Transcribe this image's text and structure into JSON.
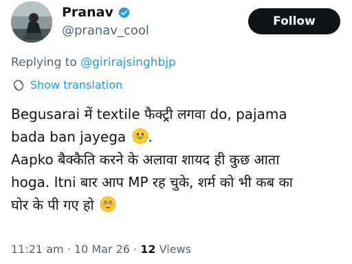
{
  "author": {
    "name": "Pranav",
    "handle": "@pranav_cool",
    "verified": true,
    "verified_color": "#1d9bf0"
  },
  "follow_button": {
    "label": "Follow"
  },
  "reply_context": {
    "prefix": "Replying to",
    "mention": "@girirajsinghbjp"
  },
  "translation": {
    "label": "Show translation",
    "icon": "globe-icon"
  },
  "tweet": {
    "lines": [
      "Begusarai में textile फैक्ट्री लगवा do, pajama",
      "bada ban jayega",
      "Aapko बैक्कैति करने के अलावा शायद ही कुछ आता",
      "hoga. Itni बार आप MP रह चुके, शर्म को भी कब का",
      "घोर के पी गए हो"
    ],
    "emojis": [
      "grinning-face-emoji",
      "flushed-face-emoji"
    ]
  },
  "meta": {
    "time": "11:21 am",
    "separator": "·",
    "date": "10 Mar 26",
    "views_count": "12",
    "views_label": "Views"
  },
  "colors": {
    "text": "#0f1419",
    "secondary": "#536471",
    "accent": "#1d9bf0",
    "button_bg": "#0f1419"
  }
}
